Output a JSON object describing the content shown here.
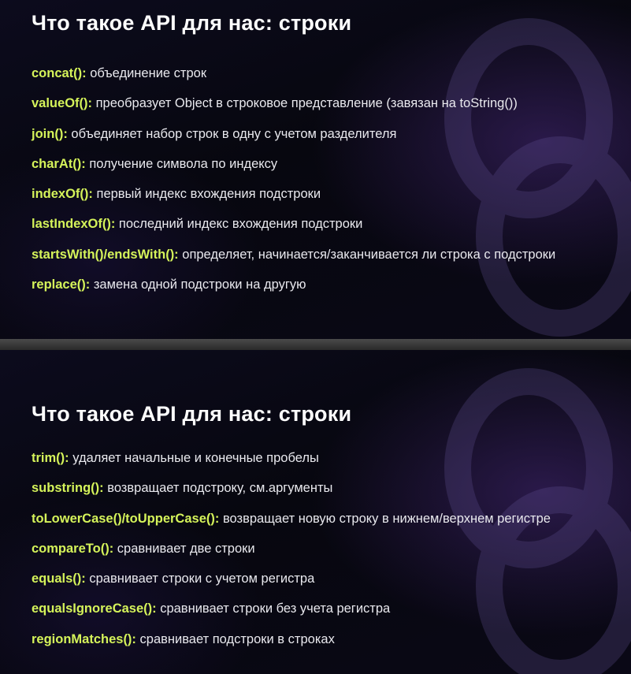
{
  "slides": [
    {
      "title": "Что такое API для нас: строки",
      "items": [
        {
          "method": "concat():",
          "desc": " объединение строк"
        },
        {
          "method": "valueOf():",
          "desc": " преобразует Object в строковое представление (завязан на toString())"
        },
        {
          "method": "join():",
          "desc": " объединяет набор строк в одну с учетом разделителя"
        },
        {
          "method": "charAt():",
          "desc": " получение символа по индексу"
        },
        {
          "method": "indexOf():",
          "desc": " первый индекс вхождения подстроки"
        },
        {
          "method": "lastIndexOf():",
          "desc": " последний индекс вхождения подстроки"
        },
        {
          "method": "startsWith()/endsWith():",
          "desc": " определяет, начинается/заканчивается ли строка с подстроки"
        },
        {
          "method": "replace():",
          "desc": " замена одной подстроки на другую"
        }
      ]
    },
    {
      "title": "Что такое API для нас: строки",
      "items": [
        {
          "method": "trim():",
          "desc": " удаляет начальные и конечные пробелы"
        },
        {
          "method": "substring():",
          "desc": " возвращает подстроку, см.аргументы"
        },
        {
          "method": "toLowerCase()/toUpperCase():",
          "desc": " возвращает новую строку в нижнем/верхнем регистре"
        },
        {
          "method": "compareTo():",
          "desc": " сравнивает две строки"
        },
        {
          "method": "equals():",
          "desc": " сравнивает строки с учетом регистра"
        },
        {
          "method": "equalsIgnoreCase():",
          "desc": " сравнивает строки без учета регистра"
        },
        {
          "method": "regionMatches():",
          "desc": " сравнивает подстроки в строках"
        }
      ]
    }
  ],
  "colors": {
    "accent": "#d5f35a",
    "text": "#e9e9ee",
    "title": "#ffffff"
  },
  "icons": {
    "background_logo": "chain-logo-icon"
  }
}
